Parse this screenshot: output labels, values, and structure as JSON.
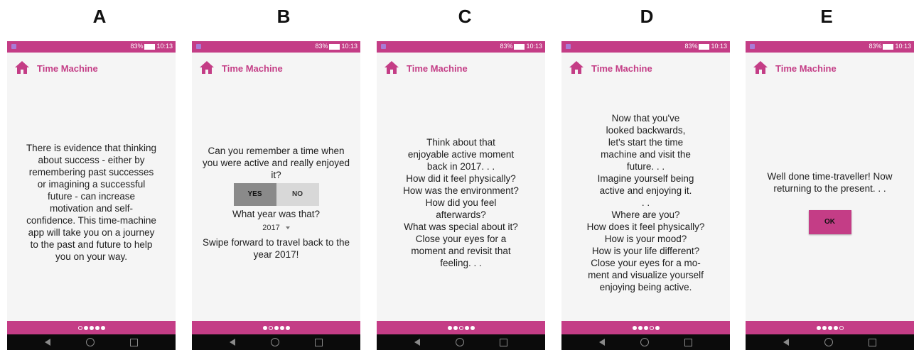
{
  "colors": {
    "accent": "#c43d86",
    "background": "#f5f5f5",
    "navbar": "#0b0b0b"
  },
  "status": {
    "battery": "83%",
    "time": "10:13"
  },
  "panels": [
    {
      "letter": "A",
      "title": "Time Machine",
      "home_icon": "home-icon",
      "active_dot": 0,
      "text": "There is evidence that thinking about success - either by remembering past successes or imagining a successful future - can increase motivation and self-confidence. This time-machine app will take you on a journey to the past and future to help you on your way."
    },
    {
      "letter": "B",
      "title": "Time Machine",
      "home_icon": "home-icon",
      "active_dot": 1,
      "question": "Can you remember a time when you were active and really enjoyed it?",
      "yes_label": "YES",
      "no_label": "NO",
      "year_question": "What year was that?",
      "year_value": "2017",
      "swipe_text": "Swipe forward to travel back to the year 2017!"
    },
    {
      "letter": "C",
      "title": "Time Machine",
      "home_icon": "home-icon",
      "active_dot": 2,
      "lines": [
        "Think about that enjoyable active moment back in 2017. . .",
        "How did it feel physically?",
        "How was the environment?",
        "How did you feel afterwards?",
        "What was special about it?",
        "Close your eyes for a moment and revisit that feeling. . ."
      ]
    },
    {
      "letter": "D",
      "title": "Time Machine",
      "home_icon": "home-icon",
      "active_dot": 3,
      "lines": [
        "Now that you've looked backwards, let's start the time machine and visit the future. . .",
        "Imagine yourself being active and enjoying it. . .",
        "Where are you?",
        "How does it feel physically?",
        "How is your mood?",
        "How is your life different?",
        "Close your eyes for a mo-ment and visualize yourself enjoying being active."
      ]
    },
    {
      "letter": "E",
      "title": "Time Machine",
      "home_icon": "home-icon",
      "active_dot": 4,
      "text": "Well done time-traveller! Now returning to the present. . .",
      "ok_label": "OK"
    }
  ]
}
